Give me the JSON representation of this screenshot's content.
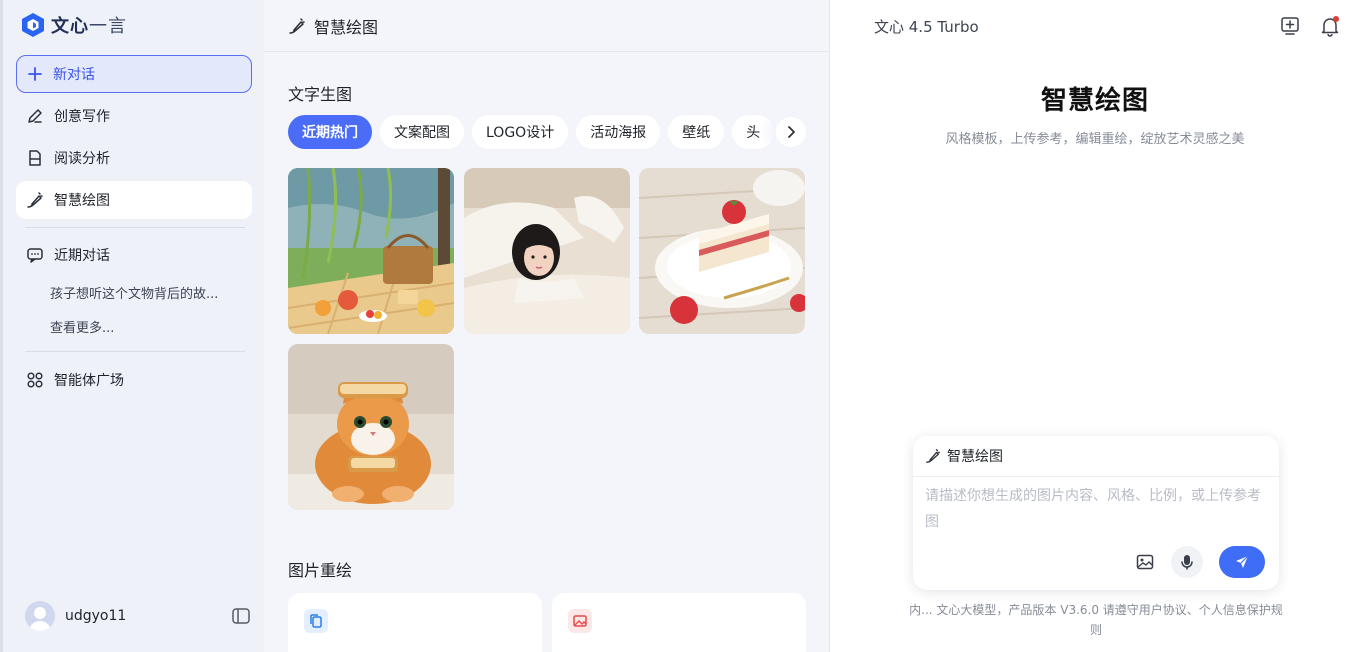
{
  "sidebar": {
    "brand": "文心",
    "brand_light": "一言",
    "new_chat": "新对话",
    "nav": [
      {
        "label": "创意写作"
      },
      {
        "label": "阅读分析"
      },
      {
        "label": "智慧绘图"
      }
    ],
    "recent_title": "近期对话",
    "recent_items": [
      "孩子想听这个文物背后的故..."
    ],
    "see_more": "查看更多...",
    "agent_plaza": "智能体广场",
    "username": "udgyo11"
  },
  "middle": {
    "header_title": "智慧绘图",
    "text_to_image_title": "文字生图",
    "chips": [
      "近期热门",
      "文案配图",
      "LOGO设计",
      "活动海报",
      "壁纸",
      "头"
    ],
    "active_chip": "近期热门",
    "redraw_title": "图片重绘"
  },
  "right": {
    "model_name": "文心 4.5 Turbo",
    "hero_title": "智慧绘图",
    "hero_subtitle": "风格模板，上传参考，编辑重绘，绽放艺术灵感之美",
    "composer_mode": "智慧绘图",
    "composer_placeholder": "请描述你想生成的图片内容、风格、比例，或上传参考图",
    "footer_note": "内... 文心大模型，产品版本 V3.6.0 请遵守用户协议、个人信息保护规则"
  },
  "colors": {
    "accent": "#4a6cf7",
    "send": "#3f6df5",
    "sidebar_bg": "#eef1f8",
    "notification_dot": "#e03b3b"
  }
}
